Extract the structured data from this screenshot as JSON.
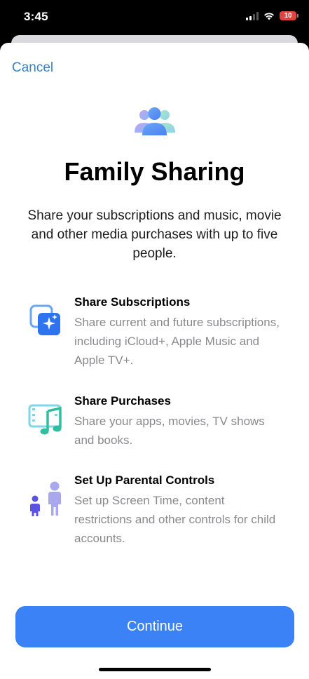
{
  "status_bar": {
    "time": "3:45",
    "battery_level": "10",
    "icons": [
      "cellular-signal-icon",
      "wifi-icon",
      "battery-icon"
    ]
  },
  "sheet": {
    "cancel_label": "Cancel",
    "hero_icon": "family-people-icon",
    "title": "Family Sharing",
    "subtitle": "Share your subscriptions and music, movie and other media purchases with up to five people.",
    "features": [
      {
        "icon": "subscriptions-icon",
        "title": "Share Subscriptions",
        "description": "Share current and future subscriptions, including iCloud+, Apple Music and Apple TV+."
      },
      {
        "icon": "purchases-music-film-icon",
        "title": "Share Purchases",
        "description": "Share your apps, movies, TV shows and books."
      },
      {
        "icon": "parent-child-icon",
        "title": "Set Up Parental Controls",
        "description": "Set up Screen Time, content restrictions and other controls for child accounts."
      }
    ],
    "continue_label": "Continue"
  },
  "colors": {
    "accent": "#3a82f6",
    "link": "#3b82c4",
    "secondary_text": "#8a8a8e"
  }
}
